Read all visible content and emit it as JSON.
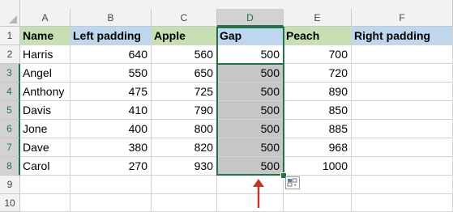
{
  "columns": [
    "A",
    "B",
    "C",
    "D",
    "E",
    "F"
  ],
  "rows": [
    "1",
    "2",
    "3",
    "4",
    "5",
    "6",
    "7",
    "8",
    "9",
    "10"
  ],
  "active_column": "D",
  "header_row": [
    "Name",
    "Left padding",
    "Apple",
    "Gap",
    "Peach",
    "Right padding"
  ],
  "header_fill_colors": [
    "#c6e0b4",
    "#bdd7ee",
    "#c6e0b4",
    "#bdd7ee",
    "#c6e0b4",
    "#bdd7ee"
  ],
  "data_rows": [
    [
      "Harris",
      "640",
      "560",
      "500",
      "700",
      ""
    ],
    [
      "Angel",
      "550",
      "650",
      "500",
      "720",
      ""
    ],
    [
      "Anthony",
      "475",
      "725",
      "500",
      "890",
      ""
    ],
    [
      "Davis",
      "410",
      "790",
      "500",
      "850",
      ""
    ],
    [
      "Jone",
      "400",
      "800",
      "500",
      "885",
      ""
    ],
    [
      "Dave",
      "380",
      "820",
      "500",
      "968",
      ""
    ],
    [
      "Carol",
      "270",
      "930",
      "500",
      "1000",
      ""
    ]
  ],
  "selection": {
    "column": "D",
    "rows": "3:8"
  },
  "colors": {
    "selection_border": "#217346",
    "selected_fill": "#c6c6c6",
    "arrow": "#c0392b"
  },
  "icons": {
    "quick_analysis": "quick-analysis-icon",
    "arrow": "up-arrow-icon"
  }
}
